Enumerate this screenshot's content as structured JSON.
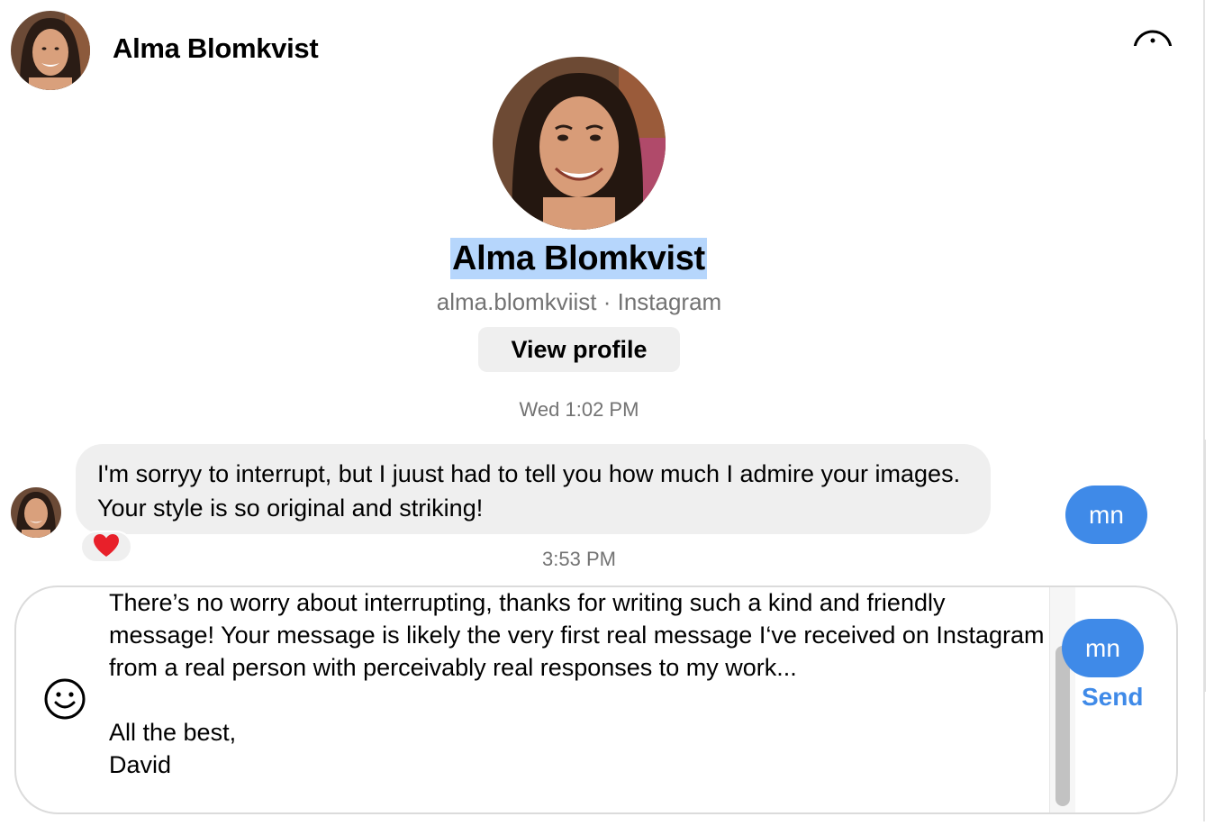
{
  "header": {
    "name": "Alma Blomkvist"
  },
  "profile": {
    "name": "Alma Blomkvist",
    "subtitle": "alma.blomkviist · Instagram",
    "view_profile_label": "View profile"
  },
  "conversation": {
    "timestamp_1": "Wed 1:02 PM",
    "incoming_message": "I'm sorryy to interrupt, but I juust had to tell you how much I admire your images. Your style is so original and striking!",
    "reaction": "❤️",
    "timestamp_2": "3:53 PM",
    "pill_1": "mn",
    "pill_2": "mn"
  },
  "composer": {
    "draft": "There’s no worry about interrupting, thanks for writing such a kind and friendly message! Your message is likely the very first real message I‘ve received on Instagram from a real person with perceivably real responses to my work...\n\nAll the best,\nDavid",
    "send_label": "Send"
  },
  "icons": {
    "emoji": "smiley-face-icon",
    "info": "info-icon"
  },
  "colors": {
    "accent": "#3f8ae8",
    "bubble": "#efefef",
    "selection": "#b6d6fc",
    "muted_text": "#737373"
  }
}
